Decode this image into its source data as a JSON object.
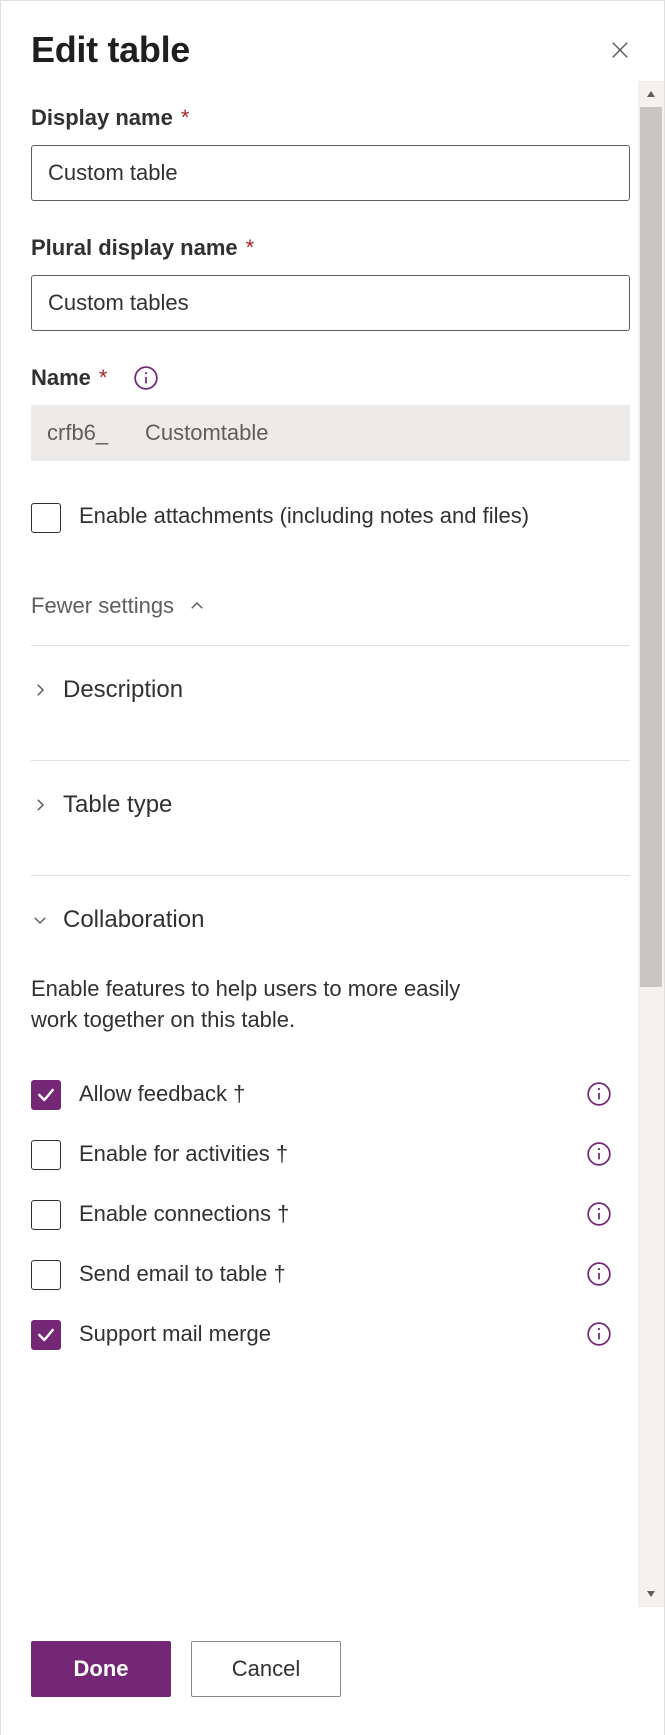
{
  "header": {
    "title": "Edit table"
  },
  "fields": {
    "display_name": {
      "label": "Display name",
      "required_marker": "*",
      "value": "Custom table"
    },
    "plural_display_name": {
      "label": "Plural display name",
      "required_marker": "*",
      "value": "Custom tables"
    },
    "name": {
      "label": "Name",
      "required_marker": "*",
      "prefix": "crfb6_",
      "value": "Customtable"
    },
    "enable_attachments": {
      "label": "Enable attachments (including notes and files)",
      "checked": false
    }
  },
  "fewer_settings_label": "Fewer settings",
  "accordions": {
    "description": {
      "label": "Description",
      "expanded": false
    },
    "table_type": {
      "label": "Table type",
      "expanded": false
    },
    "collaboration": {
      "label": "Collaboration",
      "expanded": true,
      "description": "Enable features to help users to more easily work together on this table.",
      "items": [
        {
          "label": "Allow feedback †",
          "checked": true
        },
        {
          "label": "Enable for activities †",
          "checked": false
        },
        {
          "label": "Enable connections †",
          "checked": false
        },
        {
          "label": "Send email to table †",
          "checked": false
        },
        {
          "label": "Support mail merge",
          "checked": true
        }
      ]
    }
  },
  "footer": {
    "primary": "Done",
    "secondary": "Cancel"
  },
  "colors": {
    "accent": "#742774"
  }
}
